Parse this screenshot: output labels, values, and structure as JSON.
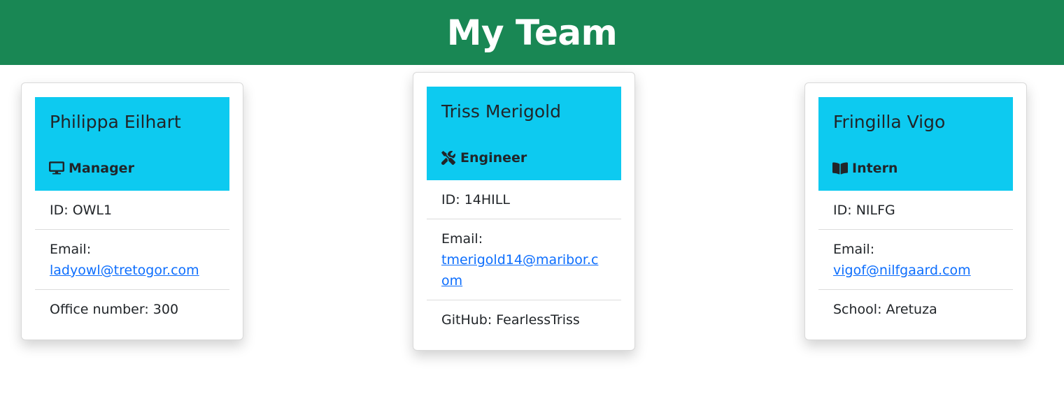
{
  "header": {
    "title": "My Team"
  },
  "colors": {
    "header_bg": "#198754",
    "card_head_bg": "#0dcaf0",
    "link": "#0d6efd"
  },
  "cards": [
    {
      "name": "Philippa Eilhart",
      "role": "Manager",
      "role_icon": "desktop-icon",
      "id_label": "ID: ",
      "id": "OWL1",
      "email_label": "Email:",
      "email": "ladyowl@tretogor.com",
      "extra_label": "Office number: ",
      "extra": "300"
    },
    {
      "name": "Triss Merigold",
      "role": "Engineer",
      "role_icon": "tools-icon",
      "id_label": "ID: ",
      "id": "14HILL",
      "email_label": "Email:",
      "email": "tmerigold14@maribor.com",
      "extra_label": "GitHub: ",
      "extra": "FearlessTriss"
    },
    {
      "name": "Fringilla Vigo",
      "role": "Intern",
      "role_icon": "book-icon",
      "id_label": "ID: ",
      "id": "NILFG",
      "email_label": "Email:",
      "email": "vigof@nilfgaard.com",
      "extra_label": "School: ",
      "extra": "Aretuza"
    }
  ]
}
